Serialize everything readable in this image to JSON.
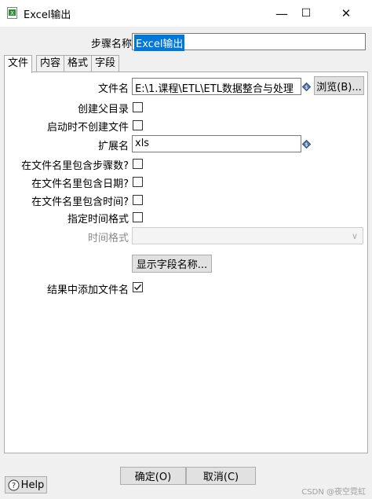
{
  "window": {
    "title": "Excel输出",
    "minimize": "—",
    "maximize": "☐",
    "close": "✕"
  },
  "step": {
    "label": "步骤名称",
    "value": "Excel输出"
  },
  "tabs": [
    {
      "label": "文件"
    },
    {
      "label": "内容"
    },
    {
      "label": "格式"
    },
    {
      "label": "字段"
    }
  ],
  "file": {
    "filename_label": "文件名",
    "filename_value": "E:\\1.课程\\ETL\\ETL数据整合与处理",
    "browse_label": "浏览(B)...",
    "create_parent_label": "创建父目录",
    "no_create_on_start_label": "启动时不创建文件",
    "extension_label": "扩展名",
    "extension_value": "xls",
    "include_step_label": "在文件名里包含步骤数?",
    "include_date_label": "在文件名里包含日期?",
    "include_time_label": "在文件名里包含时间?",
    "specify_time_format_label": "指定时间格式",
    "time_format_label": "时间格式",
    "time_format_value": "",
    "show_fields_label": "显示字段名称...",
    "add_filename_label": "结果中添加文件名",
    "add_filename_checked": true
  },
  "footer": {
    "ok_label": "确定(O)",
    "cancel_label": "取消(C)",
    "help_label": "Help"
  },
  "watermark": "CSDN @夜空霓虹"
}
